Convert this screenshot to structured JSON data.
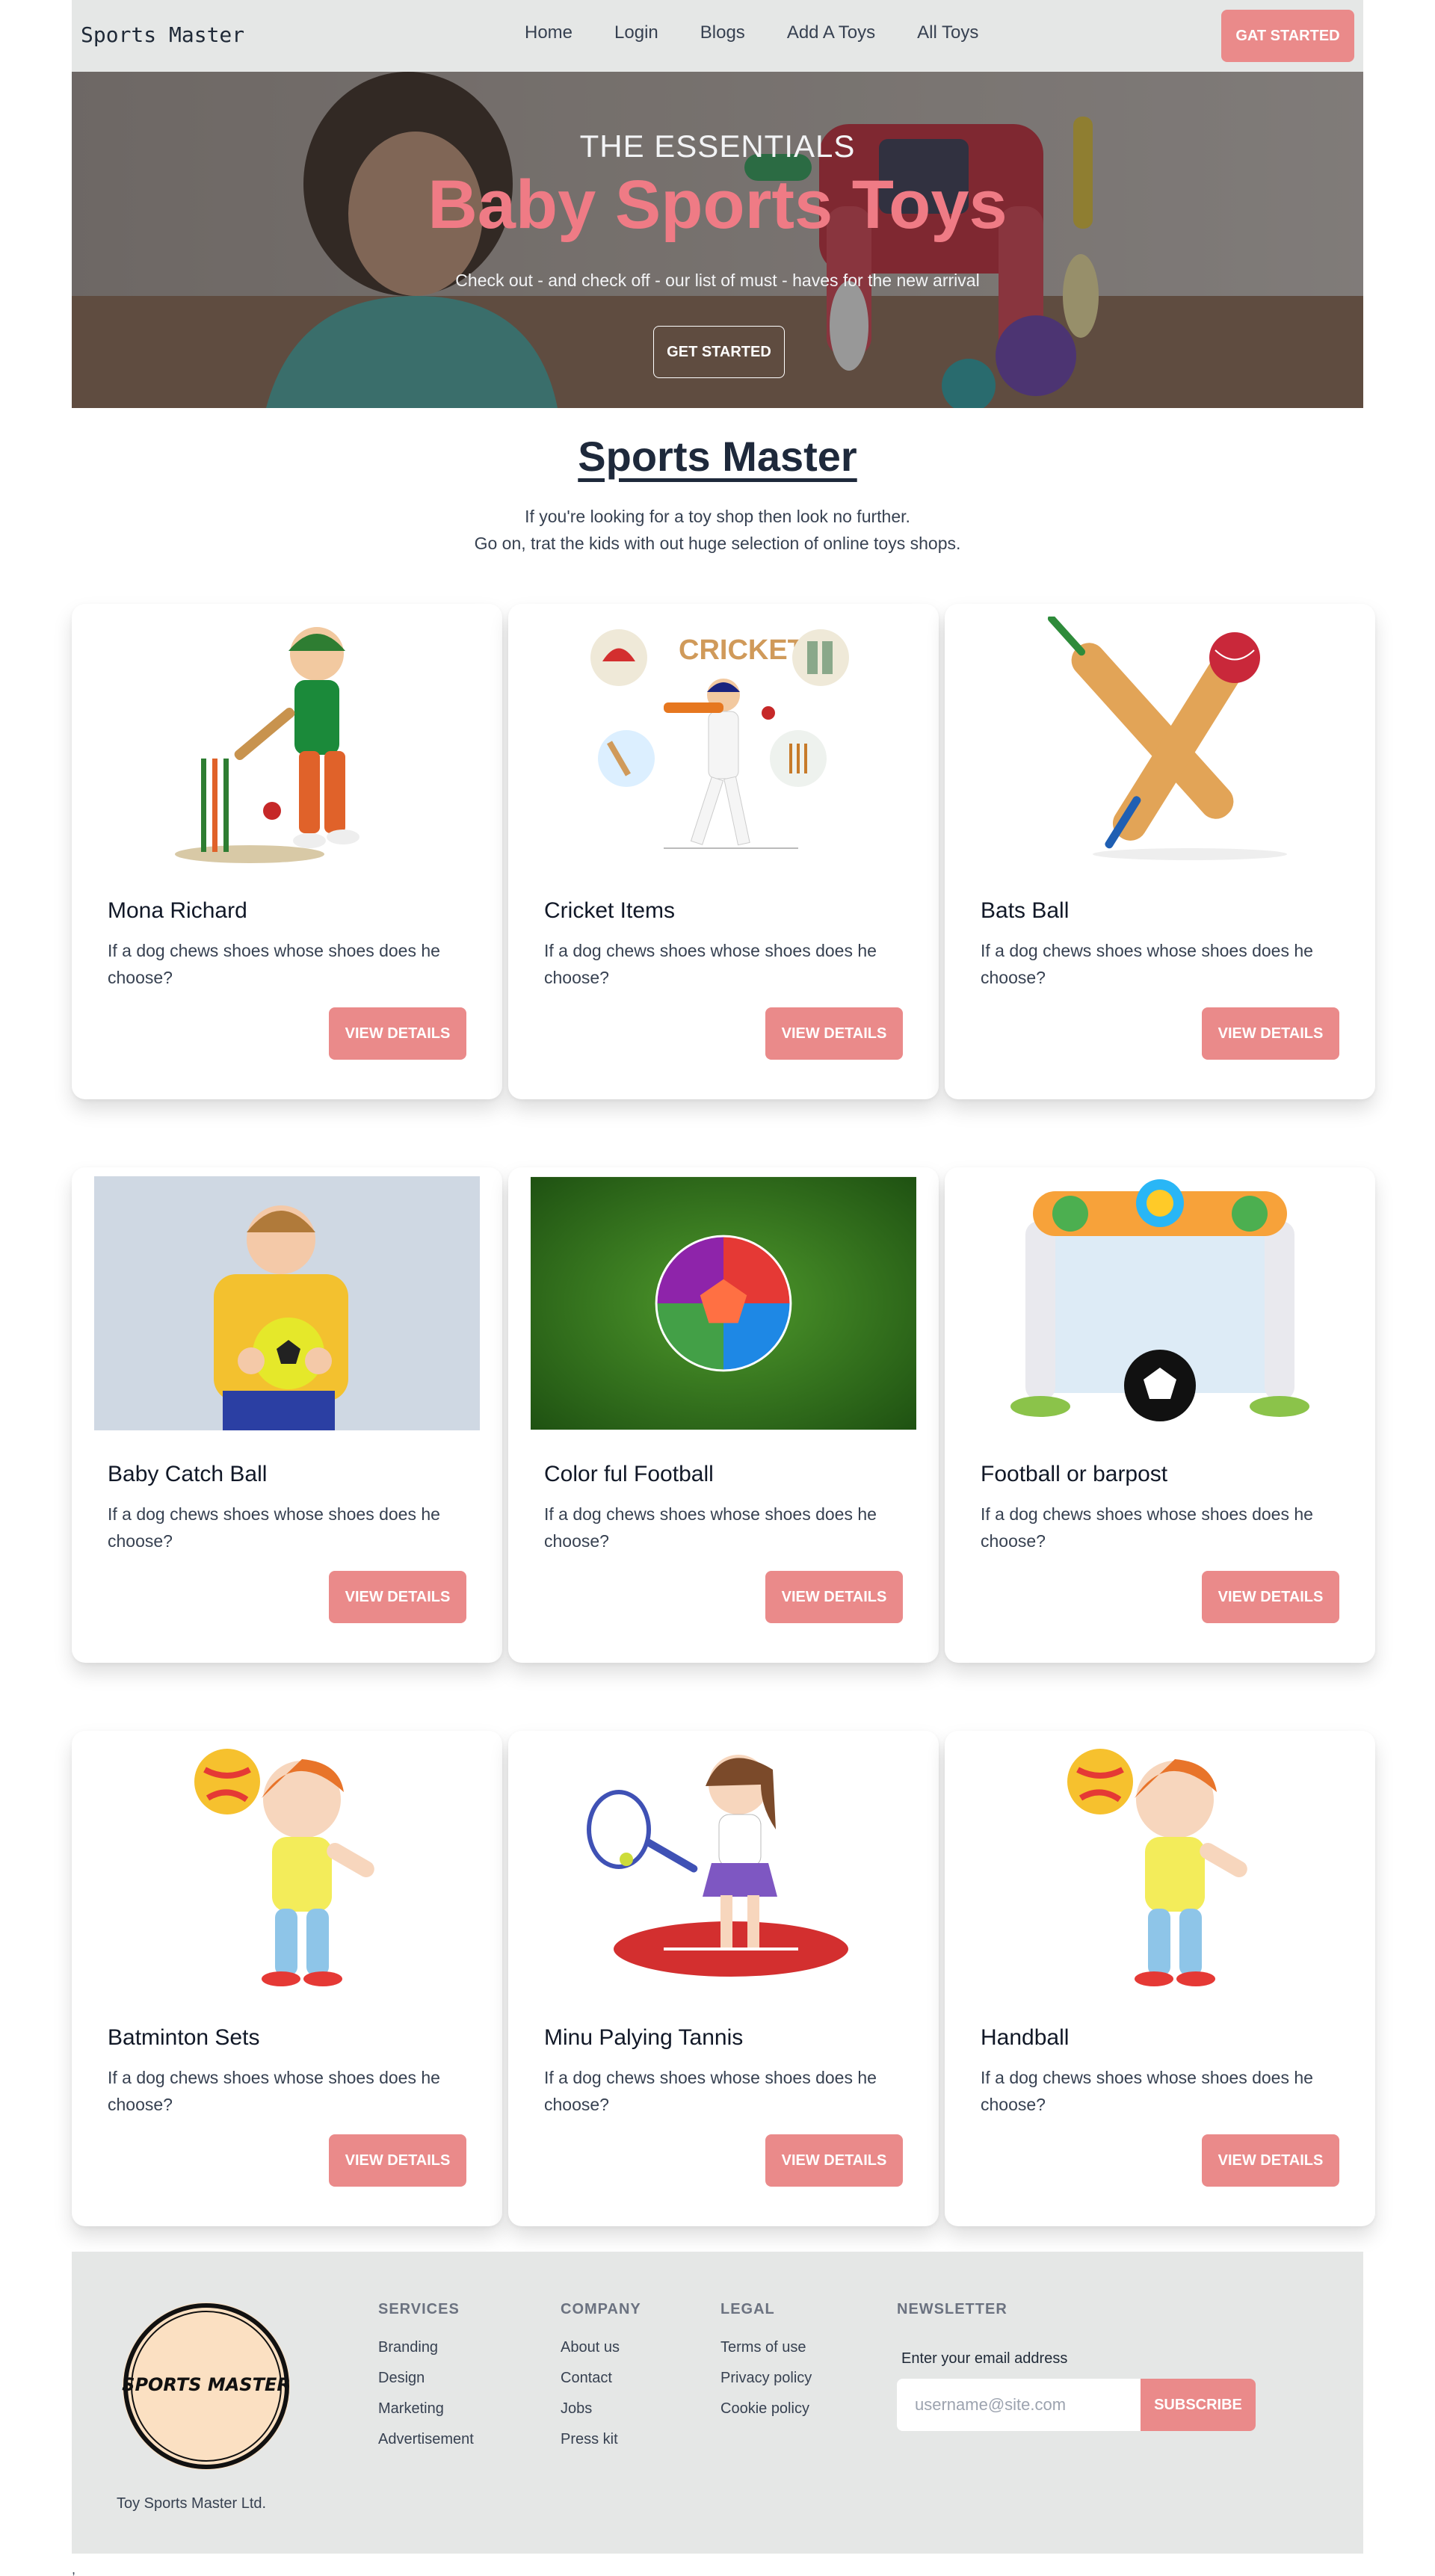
{
  "nav": {
    "brand": "Sports Master",
    "links": [
      "Home",
      "Login",
      "Blogs",
      "Add A Toys",
      "All Toys"
    ],
    "cta": "GAT STARTED"
  },
  "hero": {
    "eyebrow": "THE ESSENTIALS",
    "title": "Baby Sports Toys",
    "subtitle": "Check out - and check off - our list of must - haves for the new arrival",
    "button": "GET STARTED"
  },
  "intro": {
    "title": "Sports Master",
    "line1": "If you're looking for a toy shop then look no further.",
    "line2": "Go on, trat the kids with out huge selection of online toys shops."
  },
  "products": [
    {
      "title": "Mona Richard",
      "description": "If a dog chews shoes whose shoes does he choose?",
      "button": "VIEW DETAILS",
      "image": "cricket-boy-batting"
    },
    {
      "title": "Cricket Items",
      "description": "If a dog chews shoes whose shoes does he choose?",
      "button": "VIEW DETAILS",
      "image": "cricket-items"
    },
    {
      "title": "Bats Ball",
      "description": "If a dog chews shoes whose shoes does he choose?",
      "button": "VIEW DETAILS",
      "image": "crossed-bats-ball"
    },
    {
      "title": "Baby Catch Ball",
      "description": "If a dog chews shoes whose shoes does he choose?",
      "button": "VIEW DETAILS",
      "image": "child-with-ball"
    },
    {
      "title": "Color ful Football",
      "description": "If a dog chews shoes whose shoes does he choose?",
      "button": "VIEW DETAILS",
      "image": "colorful-football-grass"
    },
    {
      "title": "Football or barpost",
      "description": "If a dog chews shoes whose shoes does he choose?",
      "button": "VIEW DETAILS",
      "image": "toy-goalpost"
    },
    {
      "title": "Batminton Sets",
      "description": "If a dog chews shoes whose shoes does he choose?",
      "button": "VIEW DETAILS",
      "image": "boy-holding-ball"
    },
    {
      "title": "Minu Palying Tannis",
      "description": "If a dog chews shoes whose shoes does he choose?",
      "button": "VIEW DETAILS",
      "image": "girl-playing-tennis"
    },
    {
      "title": "Handball",
      "description": "If a dog chews shoes whose shoes does he choose?",
      "button": "VIEW DETAILS",
      "image": "boy-holding-ball"
    }
  ],
  "footer": {
    "logo_text": "SPORTS MASTER",
    "company": "Toy Sports Master Ltd.",
    "services": {
      "heading": "SERVICES",
      "links": [
        "Branding",
        "Design",
        "Marketing",
        "Advertisement"
      ]
    },
    "company_col": {
      "heading": "COMPANY",
      "links": [
        "About us",
        "Contact",
        "Jobs",
        "Press kit"
      ]
    },
    "legal": {
      "heading": "LEGAL",
      "links": [
        "Terms of use",
        "Privacy policy",
        "Cookie policy"
      ]
    },
    "newsletter": {
      "heading": "NEWSLETTER",
      "label": "Enter your email address",
      "placeholder": "username@site.com",
      "button": "SUBSCRIBE"
    }
  },
  "stray_char": ","
}
